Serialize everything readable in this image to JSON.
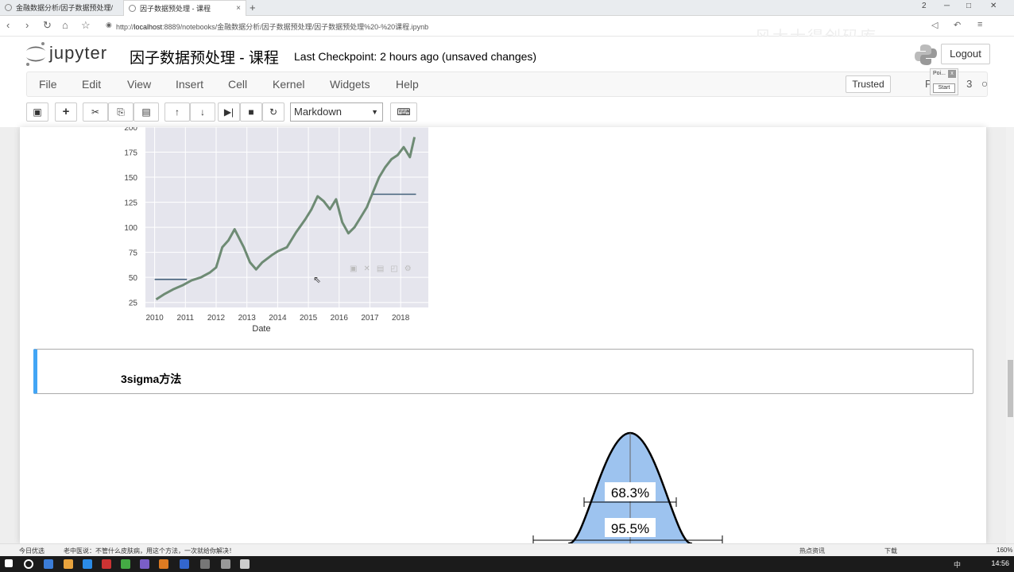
{
  "browser": {
    "tabs": [
      {
        "label": "金融数据分析/因子数据预处理/"
      },
      {
        "label": "因子数据预处理 - 课程"
      }
    ],
    "new_tab": "+",
    "url_prefix": "http://",
    "url_host": "localhost",
    "url_rest": ":8889/notebooks/金融数据分析/因子数据预处理/因子数据预处理%20-%20课程.ipynb",
    "window_buttons": [
      "2",
      "─",
      "□",
      "✕"
    ],
    "watermark": "风大士得创码库"
  },
  "jupyter": {
    "logo_text": "jupyter",
    "notebook_title": "因子数据预处理 - 课程",
    "checkpoint": "Last Checkpoint: 2 hours ago (unsaved changes)",
    "logout": "Logout",
    "trusted": "Trusted",
    "kernel_label": "P",
    "kernel_num": "3",
    "popup_label": "Poi...",
    "popup_start": "Start",
    "menu": [
      "File",
      "Edit",
      "View",
      "Insert",
      "Cell",
      "Kernel",
      "Widgets",
      "Help"
    ],
    "cell_type": "Markdown"
  },
  "markdown_cell": {
    "text": "3sigma方法"
  },
  "figure": {
    "band1": "68.3%",
    "band2": "95.5%"
  },
  "chart_data": {
    "type": "line",
    "xlabel": "Date",
    "x_ticks": [
      "2010",
      "2011",
      "2012",
      "2013",
      "2014",
      "2015",
      "2016",
      "2017",
      "2018"
    ],
    "y_ticks": [
      25,
      50,
      75,
      100,
      125,
      150,
      175,
      200
    ],
    "ylim": [
      20,
      200
    ],
    "xlim": [
      2009.7,
      2018.9
    ],
    "series": [
      {
        "color": "#6e8b74",
        "x": [
          2010.05,
          2010.3,
          2010.6,
          2010.9,
          2011.2,
          2011.5,
          2011.8,
          2012.0,
          2012.2,
          2012.4,
          2012.6,
          2012.9,
          2013.1,
          2013.3,
          2013.5,
          2013.8,
          2014.0,
          2014.3,
          2014.6,
          2014.9,
          2015.1,
          2015.3,
          2015.5,
          2015.7,
          2015.9,
          2016.1,
          2016.3,
          2016.5,
          2016.7,
          2016.9,
          2017.1,
          2017.3,
          2017.5,
          2017.7,
          2017.9,
          2018.1,
          2018.3,
          2018.45
        ],
        "y": [
          28,
          33,
          38,
          42,
          47,
          50,
          55,
          60,
          80,
          87,
          98,
          80,
          65,
          58,
          65,
          72,
          76,
          80,
          95,
          108,
          118,
          131,
          126,
          118,
          128,
          105,
          94,
          100,
          110,
          120,
          135,
          150,
          160,
          168,
          172,
          180,
          170,
          190
        ]
      },
      {
        "color": "#43607a",
        "x": [
          2010.0,
          2011.05
        ],
        "y": [
          48,
          48
        ]
      },
      {
        "color": "#43607a",
        "x": [
          2017.1,
          2018.5
        ],
        "y": [
          133,
          133
        ]
      }
    ]
  },
  "statusbar": {
    "left1": "今日优选",
    "left2": "老中医说：不管什么皮肤病，用这个方法，一次就给你解决！",
    "right1": "热点资讯",
    "right2": "下载",
    "zoom": "160%"
  },
  "taskbar": {
    "ime": "中",
    "time": "14:56"
  }
}
